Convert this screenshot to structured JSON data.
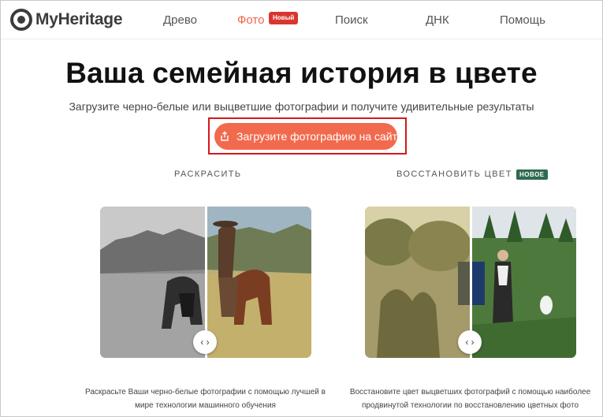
{
  "header": {
    "logo_text": "MyHeritage",
    "nav": [
      {
        "label": "Древо"
      },
      {
        "label": "Фото"
      },
      {
        "label": "Поиск"
      },
      {
        "label": "ДНК"
      },
      {
        "label": "Помощь"
      }
    ],
    "photo_badge": "Новый",
    "active_color": "#f0644a"
  },
  "hero": {
    "title": "Ваша семейная история в цвете",
    "subtitle": "Загрузите черно-белые или выцветшие фотографии и получите удивительные результаты",
    "upload_button": "Загрузите фотографию на сайт",
    "upload_icon": "upload-icon",
    "button_color": "#f26a4e",
    "highlight_color": "#d21a1a"
  },
  "sections": {
    "colorize": {
      "label": "РАСКРАСИТЬ",
      "caption_line1": "Раскрасьте Ваши черно-белые фотографии с помощью лучшей в",
      "caption_line2": "мире технологии машинного обучения"
    },
    "restore": {
      "label": "ВОССТАНОВИТЬ ЦВЕТ",
      "badge": "НОВОЕ",
      "badge_color": "#2f6b52",
      "caption_line1": "Восстановите цвет выцветших фотографий с помощью наиболее",
      "caption_line2": "продвинутой технологии по восстановлению цветных фото"
    }
  },
  "slider_glyph": "‹ ›"
}
